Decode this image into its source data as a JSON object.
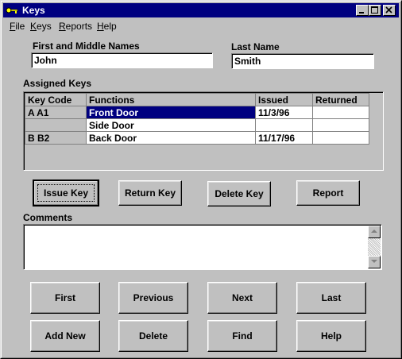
{
  "window": {
    "title": "Keys",
    "colors": {
      "titlebar": "#000080",
      "face": "#c0c0c0",
      "selection": "#000080"
    }
  },
  "titlebar_buttons": {
    "minimize": "minimize-icon",
    "maximize": "maximize-icon",
    "close": "close-icon"
  },
  "menu": [
    {
      "label": "File",
      "mnemonic": "F"
    },
    {
      "label": "Keys",
      "mnemonic": "K"
    },
    {
      "label": "Reports",
      "mnemonic": "R"
    },
    {
      "label": "Help",
      "mnemonic": "H"
    }
  ],
  "form": {
    "first_names_label": "First and Middle Names",
    "first_names_value": "John",
    "last_name_label": "Last Name",
    "last_name_value": "Smith"
  },
  "assigned_keys": {
    "label": "Assigned Keys",
    "columns": [
      "Key Code",
      "Functions",
      "Issued",
      "Returned"
    ],
    "rows": [
      {
        "key_code": "A A1",
        "function": "Front Door",
        "issued": "11/3/96",
        "returned": ""
      },
      {
        "key_code": "",
        "function": "Side Door",
        "issued": "",
        "returned": ""
      },
      {
        "key_code": "B B2",
        "function": "Back Door",
        "issued": "11/17/96",
        "returned": ""
      }
    ],
    "selected_row": 0
  },
  "key_actions": {
    "issue": "Issue Key",
    "return": "Return Key",
    "delete": "Delete Key",
    "report": "Report"
  },
  "comments": {
    "label": "Comments",
    "value": ""
  },
  "nav_buttons": {
    "first": "First",
    "previous": "Previous",
    "next": "Next",
    "last": "Last",
    "add_new": "Add New",
    "delete": "Delete",
    "find": "Find",
    "help": "Help"
  }
}
